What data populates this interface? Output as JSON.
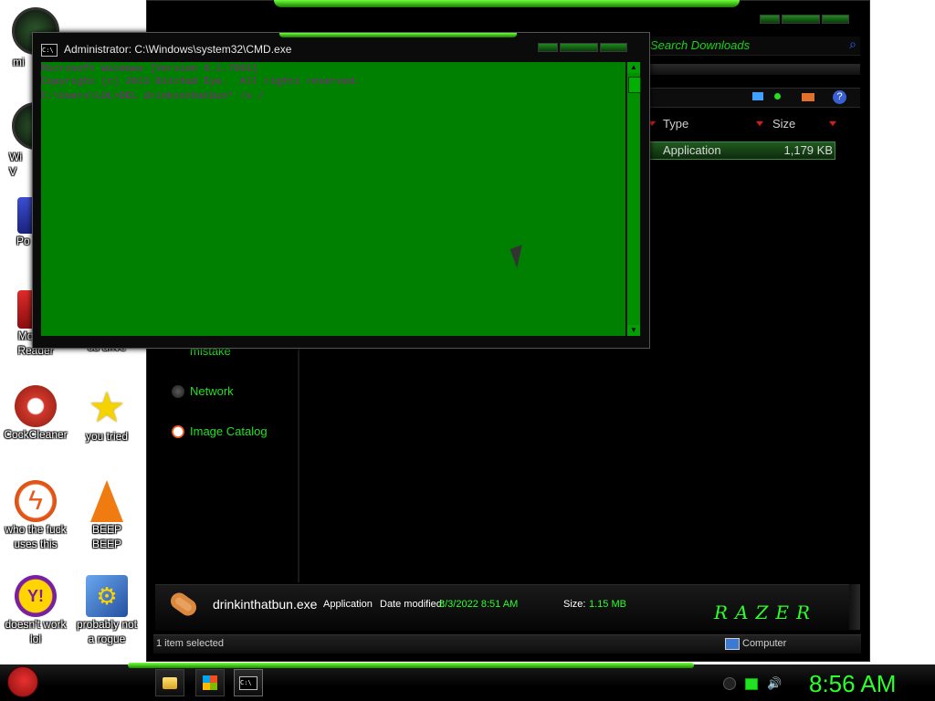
{
  "desktop": {
    "icons": [
      {
        "label": "mi",
        "color": "#1a1a1a"
      },
      {
        "label": "Wi\nV",
        "color": "#1a1a1a"
      },
      {
        "label": "Po",
        "color": "#1f2c8a"
      },
      {
        "label": "Mobius\nReader",
        "color": "#b51919"
      },
      {
        "label": "cd drive",
        "color": "#cccccc"
      },
      {
        "label": "CockCleaner",
        "color": "#d0382b"
      },
      {
        "label": "you tried",
        "color": "#f4d300"
      },
      {
        "label": "who the fuck\nuses this",
        "color": "#e85a1a"
      },
      {
        "label": "BEEP\nBEEP",
        "color": "#f07b10"
      },
      {
        "label": "doesn't work\nlol",
        "color": "#7a1fa2"
      },
      {
        "label": "probably not\na rogue",
        "color": "#3a7ad0"
      }
    ]
  },
  "explorer": {
    "search_placeholder": "Search Downloads",
    "columns": {
      "type": "Type",
      "size": "Size"
    },
    "file_row": {
      "type": "Application",
      "size": "1,179 KB"
    },
    "nav": [
      "mistake",
      "Network",
      "Image Catalog"
    ],
    "details": {
      "filename": "drinkinthatbun.exe",
      "kind": "Application",
      "date_label": "Date modified:",
      "date_value": "8/3/2022 8:51 AM",
      "size_label": "Size:",
      "size_value": "1.15 MB"
    },
    "brand": "RAZER",
    "status": {
      "selection": "1 item selected",
      "location": "Computer"
    }
  },
  "cmd": {
    "title": "Administrator: C:\\Windows\\system32\\CMD.exe",
    "lines": [
      "Microsoft Windows [Version 6.1.7601]",
      "Copyright (c) 2013 Bitchad Eye.  All rights reserved.",
      "",
      "C:\\Users\\LOL>DEL drinkinthatbun* /s /"
    ],
    "text_color": "#8a1f8a",
    "bg_color": "#008000"
  },
  "taskbar": {
    "clock": "8:56 AM",
    "buttons": [
      "folder-icon",
      "windows-logo-icon",
      "cmd-icon"
    ]
  },
  "colors": {
    "accent": "#22e022",
    "console": "#008000"
  }
}
